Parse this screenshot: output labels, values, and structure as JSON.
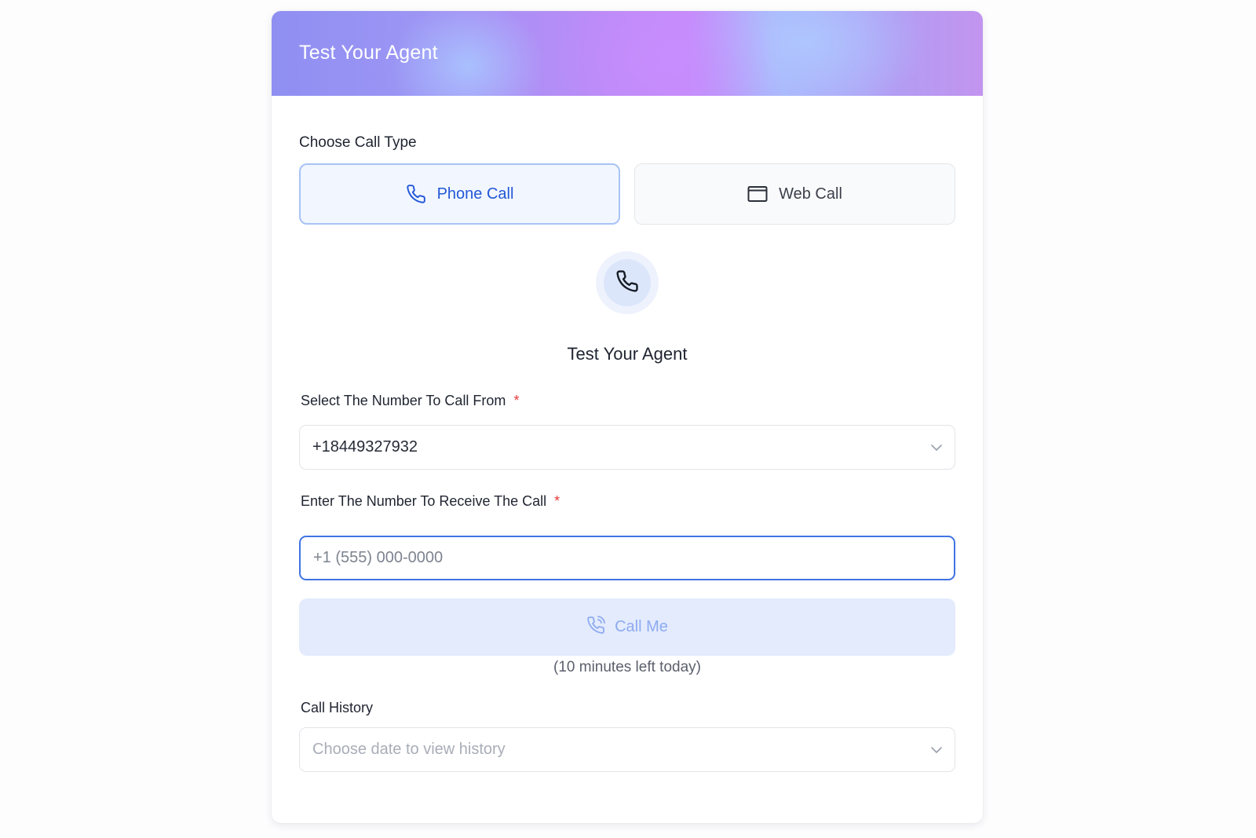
{
  "header": {
    "title": "Test Your Agent"
  },
  "call_type": {
    "label": "Choose Call Type",
    "options": [
      {
        "label": "Phone Call",
        "icon": "phone-icon",
        "selected": true
      },
      {
        "label": "Web Call",
        "icon": "browser-window-icon",
        "selected": false
      }
    ]
  },
  "center": {
    "icon": "phone-icon",
    "title": "Test Your Agent"
  },
  "from_number": {
    "label": "Select The Number To Call From",
    "required_mark": "*",
    "value": "+18449327932"
  },
  "to_number": {
    "label": "Enter The Number To Receive The Call",
    "required_mark": "*",
    "placeholder": "+1 (555) 000-0000",
    "value": ""
  },
  "call_button": {
    "label": "Call Me",
    "icon": "phone-ringing-icon"
  },
  "minutes_left": "(10 minutes left today)",
  "call_history": {
    "label": "Call History",
    "placeholder": "Choose date to view history"
  },
  "colors": {
    "accent": "#2257d6",
    "required": "#e23b3b",
    "call_button_bg": "#e3ebfd",
    "focus_border": "#3f74e2"
  }
}
